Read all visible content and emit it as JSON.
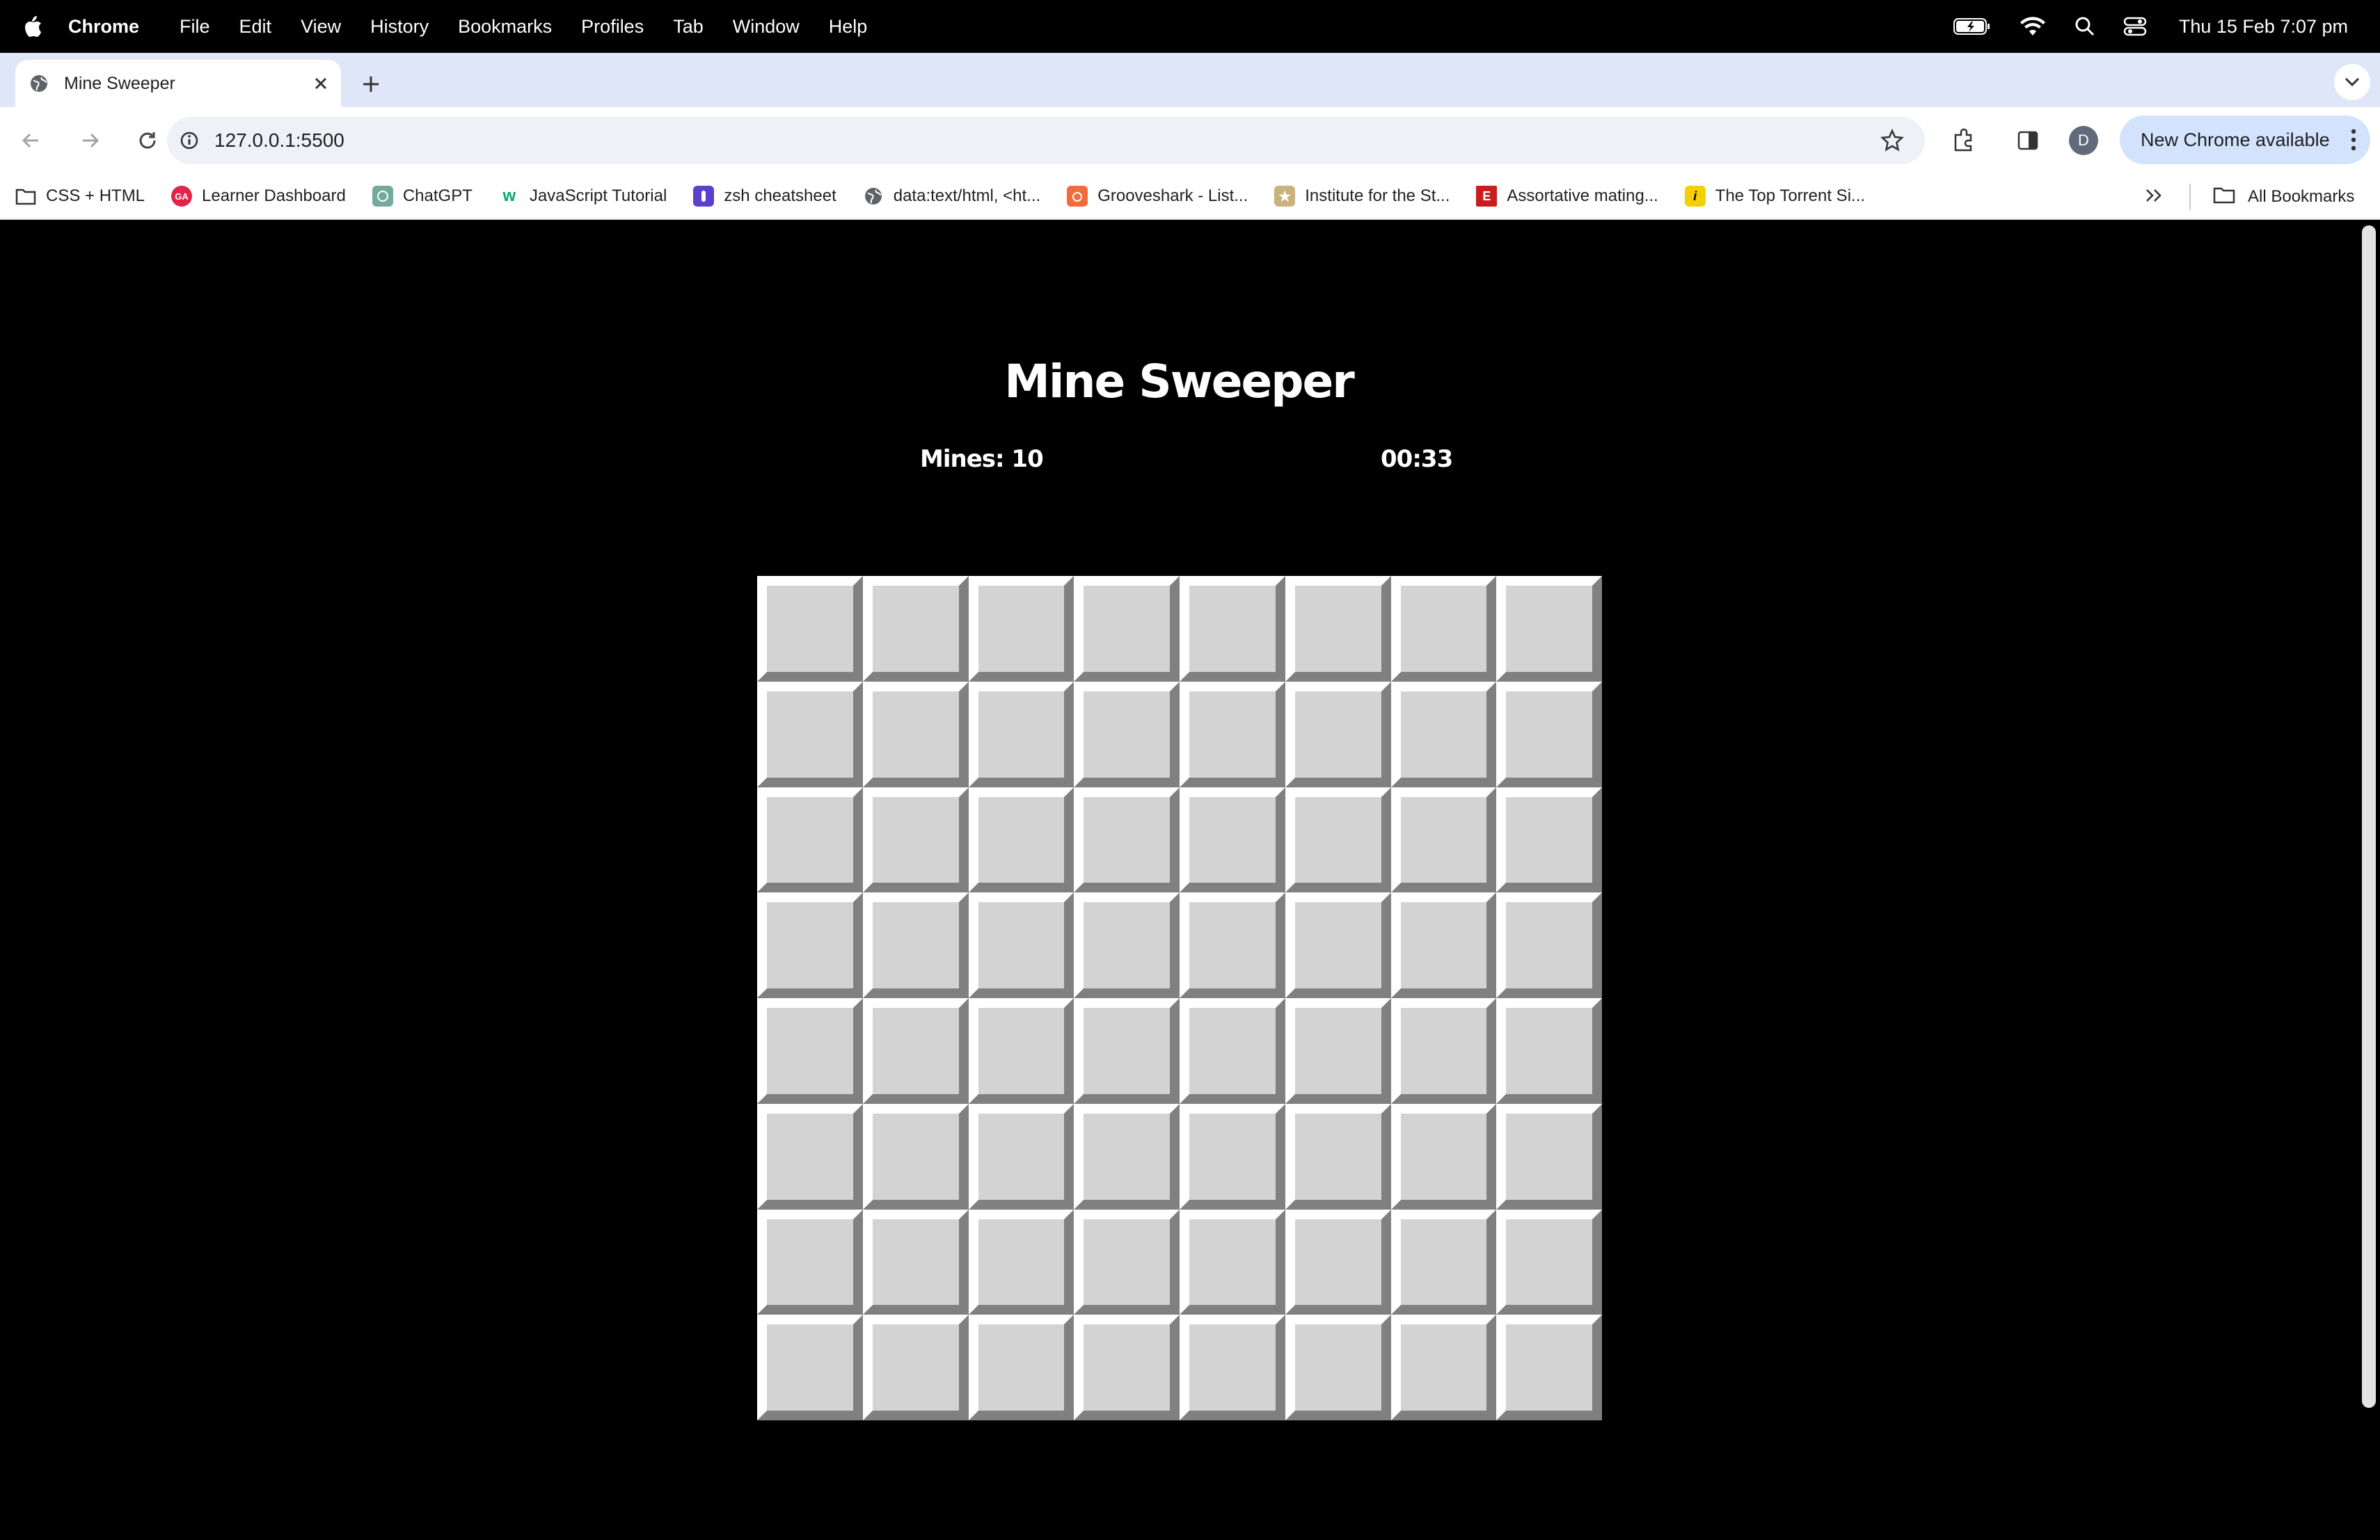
{
  "menubar": {
    "app_name": "Chrome",
    "items": [
      "File",
      "Edit",
      "View",
      "History",
      "Bookmarks",
      "Profiles",
      "Tab",
      "Window",
      "Help"
    ],
    "clock": "Thu 15 Feb  7:07 pm"
  },
  "tab": {
    "title": "Mine Sweeper"
  },
  "toolbar": {
    "url": "127.0.0.1:5500",
    "profile_initial": "D",
    "update_label": "New Chrome available"
  },
  "bookmarks": {
    "items": [
      {
        "label": "CSS + HTML",
        "icon": "folder-icon"
      },
      {
        "label": "Learner Dashboard",
        "icon": "ga-icon"
      },
      {
        "label": "ChatGPT",
        "icon": "chatgpt-icon"
      },
      {
        "label": "JavaScript Tutorial",
        "icon": "w3-icon"
      },
      {
        "label": "zsh cheatsheet",
        "icon": "zsh-icon"
      },
      {
        "label": "data:text/html, <ht...",
        "icon": "globe-icon"
      },
      {
        "label": "Grooveshark - List...",
        "icon": "grooveshark-icon"
      },
      {
        "label": "Institute for the St...",
        "icon": "institute-icon"
      },
      {
        "label": "Assortative mating...",
        "icon": "e-icon"
      },
      {
        "label": "The Top Torrent Si...",
        "icon": "i-icon"
      }
    ],
    "all_label": "All Bookmarks"
  },
  "game": {
    "title": "Mine Sweeper",
    "mines_label": "Mines: 10",
    "timer": "00:33",
    "rows": 8,
    "cols": 8
  },
  "colors": {
    "cell_face": "#d3d3d3",
    "cell_highlight": "#ffffff",
    "cell_shadow": "#808080",
    "page_background": "#000000"
  }
}
